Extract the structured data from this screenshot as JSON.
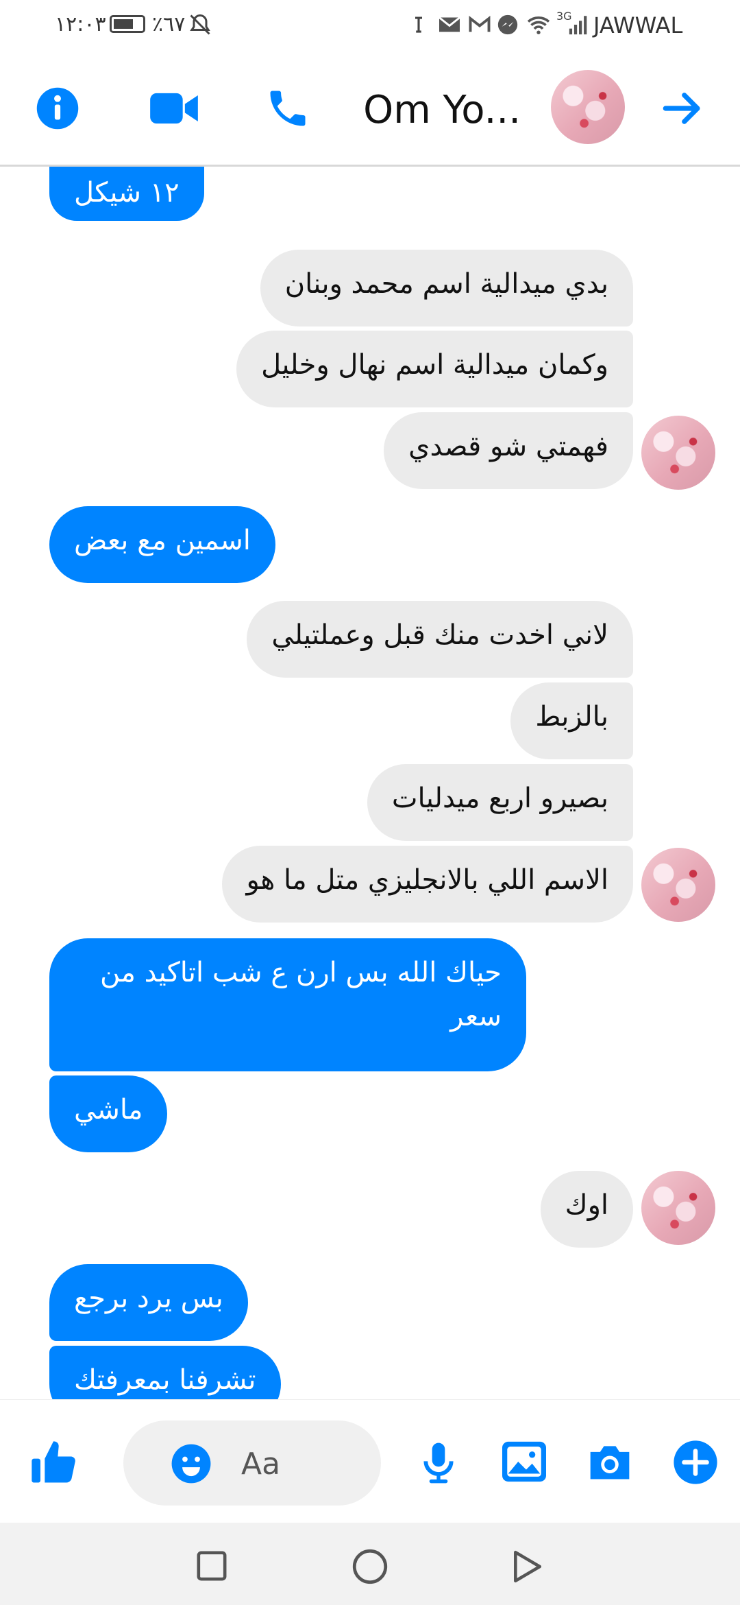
{
  "status_bar": {
    "time": "١٢:٠٣",
    "battery": "٪٦٧",
    "carrier": "JAWWAL",
    "network": "3G"
  },
  "header": {
    "contact_name": "Om Yo...",
    "icons": [
      "info-icon",
      "video-call-icon",
      "phone-icon",
      "forward-arrow-icon"
    ]
  },
  "messages": [
    {
      "side": "out",
      "text": "١٢ شيكل"
    },
    {
      "side": "in",
      "text": "بدي ميدالية اسم محمد وبنان"
    },
    {
      "side": "in",
      "text": "وكمان ميدالية اسم نهال وخليل"
    },
    {
      "side": "in",
      "text": "فهمتي شو قصدي"
    },
    {
      "side": "out",
      "text": "اسمين مع بعض"
    },
    {
      "side": "in",
      "text": "لاني اخدت منك قبل وعملتيلي"
    },
    {
      "side": "in",
      "text": "بالزبط"
    },
    {
      "side": "in",
      "text": "بصيرو اربع ميدليات"
    },
    {
      "side": "in",
      "text": "الاسم اللي بالانجليزي متل ما هو"
    },
    {
      "side": "out",
      "text": "حياك الله بس ارن ع شب اتاكيد من",
      "text2": "سعر"
    },
    {
      "side": "out",
      "text": "ماشي"
    },
    {
      "side": "in",
      "text": "اوك"
    },
    {
      "side": "out",
      "text": "بس يرد برجع"
    },
    {
      "side": "out",
      "text": "تشرفنا بمعرفتك"
    }
  ],
  "composer": {
    "placeholder": "Aa",
    "icons": [
      "like-icon",
      "emoji-icon",
      "microphone-icon",
      "gallery-icon",
      "camera-icon",
      "plus-icon"
    ]
  },
  "nav": {
    "icons": [
      "recent-apps-icon",
      "home-icon",
      "back-icon"
    ]
  },
  "colors": {
    "accent": "#0084ff",
    "incoming_bubble": "#ebebeb"
  }
}
